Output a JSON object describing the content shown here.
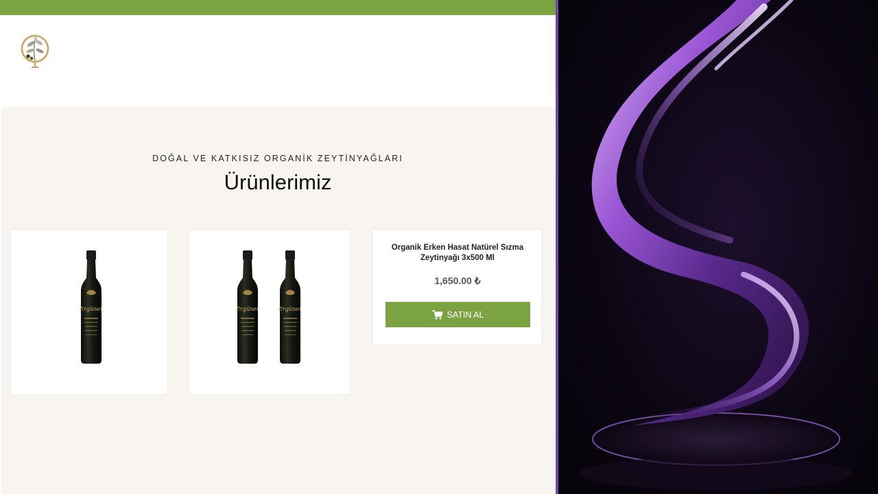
{
  "section": {
    "eyebrow": "DOĞAL VE KATKISIZ ORGANİK ZEYTİNYAĞLARI",
    "heading": "Ürünlerimiz"
  },
  "products": [
    {
      "image": "single-olive-oil-bottle",
      "label_text": "Ergüner"
    },
    {
      "image": "two-olive-oil-bottles",
      "label_text": "Ergüner"
    },
    {
      "title": "Organik Erken Hasat Natürel Sızma Zeytinyağı 3x500 Ml",
      "price": "1,650.00 ₺",
      "button_label": "SATIN AL",
      "button_icon": "cart-icon"
    }
  ],
  "colors": {
    "brand_green": "#7ca342",
    "section_bg": "#f8f5f0",
    "art_accent": "#a35be0"
  }
}
